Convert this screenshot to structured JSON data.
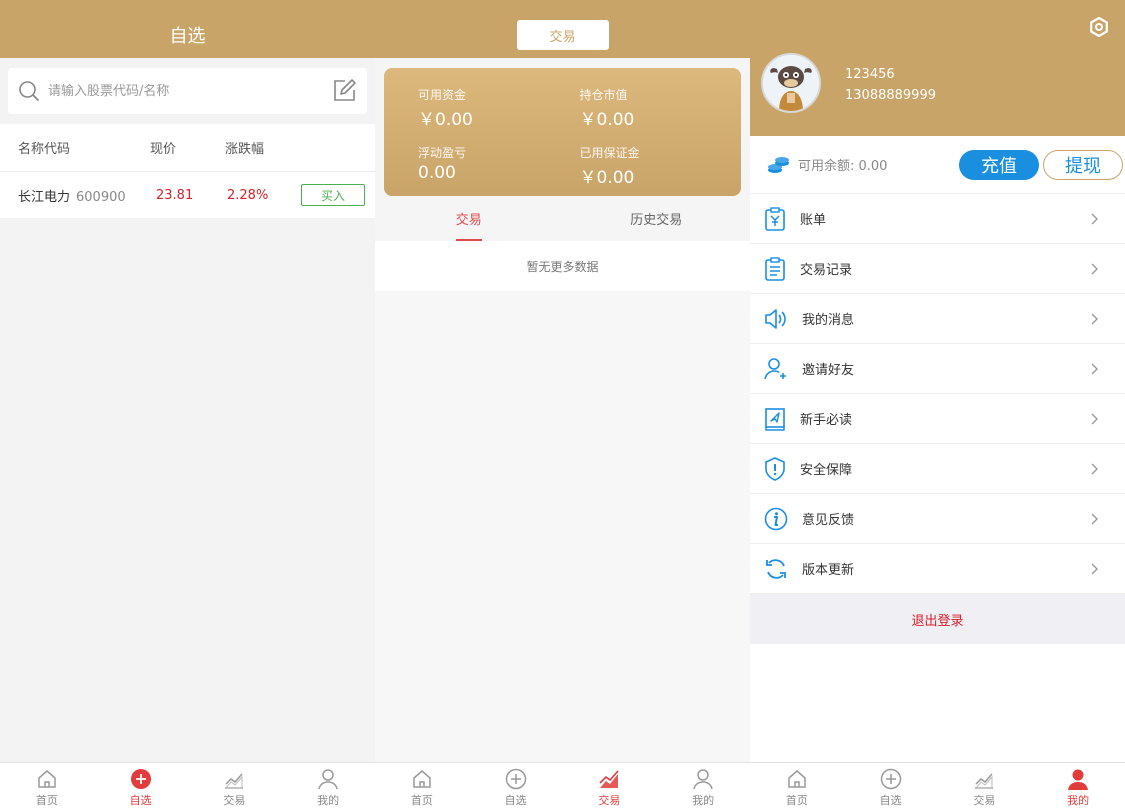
{
  "panel_watchlist": {
    "header_title": "自选",
    "search_placeholder": "请输入股票代码/名称",
    "columns": [
      "名称代码",
      "现价",
      "涨跌幅"
    ],
    "stocks": [
      {
        "name": "长江电力",
        "code": "600900",
        "price": "23.81",
        "change": "2.28%",
        "action": "买入"
      }
    ]
  },
  "panel_trade": {
    "top_tab": "交易",
    "assets": [
      {
        "label": "可用资金",
        "value": "￥0.00"
      },
      {
        "label": "持仓市值",
        "value": "￥0.00"
      },
      {
        "label": "浮动盈亏",
        "value": "0.00"
      },
      {
        "label": "已用保证金",
        "value": "￥0.00"
      }
    ],
    "subtabs": [
      "交易",
      "历史交易"
    ],
    "empty_text": "暂无更多数据"
  },
  "panel_mine": {
    "user_id": "123456",
    "phone": "13088889999",
    "balance_text": "可用余额: 0.00",
    "recharge_label": "充值",
    "withdraw_label": "提现",
    "menu": [
      {
        "label": "账单",
        "icon": "bill-icon"
      },
      {
        "label": "交易记录",
        "icon": "clipboard-icon"
      },
      {
        "label": "我的消息",
        "icon": "speaker-icon"
      },
      {
        "label": "邀请好友",
        "icon": "add-user-icon"
      },
      {
        "label": "新手必读",
        "icon": "guide-book-icon"
      },
      {
        "label": "安全保障",
        "icon": "shield-icon"
      },
      {
        "label": "意见反馈",
        "icon": "info-icon"
      },
      {
        "label": "版本更新",
        "icon": "refresh-icon"
      }
    ],
    "logout_label": "退出登录"
  },
  "tabbar": {
    "items": [
      "首页",
      "自选",
      "交易",
      "我的"
    ]
  },
  "colors": {
    "brand_gold": "#c9a468",
    "up_red": "#d81e2a",
    "active_tab_red": "#e23b3b",
    "icon_blue": "#1a8fe0",
    "buy_green": "#4caf50"
  }
}
